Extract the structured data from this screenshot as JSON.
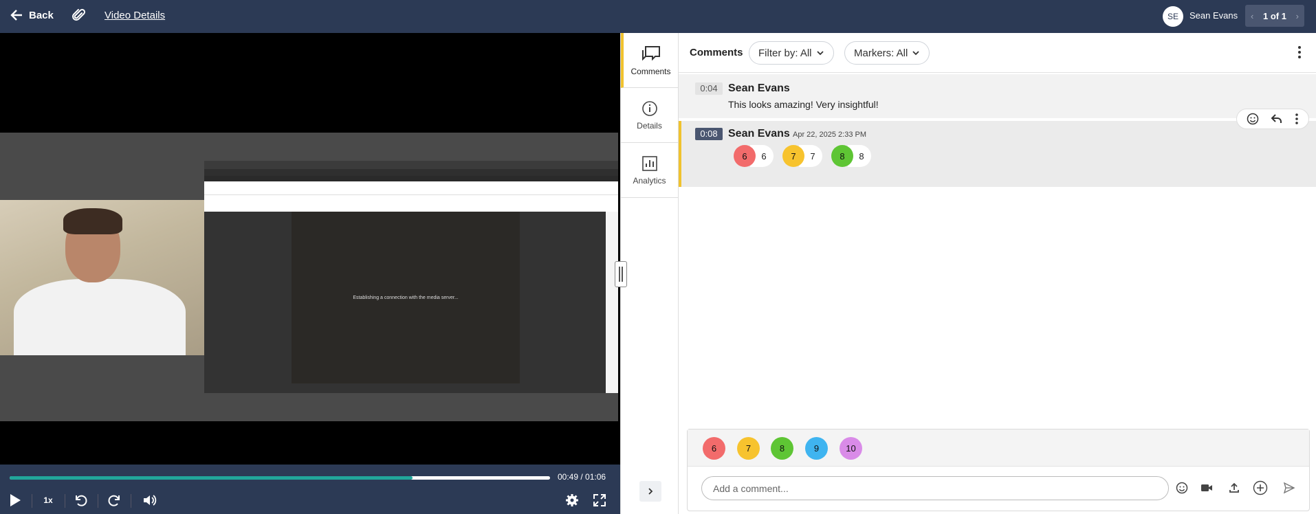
{
  "header": {
    "back_label": "Back",
    "title": "Video Details",
    "avatar_initials": "SE",
    "user_name": "Sean Evans",
    "pager": "1 of 1"
  },
  "video": {
    "screen_message": "Establishing a connection with the media server...",
    "time": "00:49 / 01:06",
    "progress": 0.745,
    "speed": "1x",
    "accent_color": "#21a69a"
  },
  "rail": {
    "comments": "Comments",
    "details": "Details",
    "analytics": "Analytics"
  },
  "panel": {
    "title": "Comments",
    "filter_label": "Filter by: All",
    "markers_label": "Markers: All"
  },
  "comments": [
    {
      "timestamp": "0:04",
      "author": "Sean Evans",
      "text": "This looks amazing!  Very insightful!"
    },
    {
      "timestamp": "0:08",
      "author": "Sean Evans",
      "date": "Apr 22, 2025 2:33 PM",
      "markers": [
        {
          "label": "6",
          "value": "6",
          "color": "#f26b6b"
        },
        {
          "label": "7",
          "value": "7",
          "color": "#f7c32e"
        },
        {
          "label": "8",
          "value": "8",
          "color": "#5ec534"
        }
      ]
    }
  ],
  "composer": {
    "markers": [
      {
        "label": "6",
        "color": "#f26b6b"
      },
      {
        "label": "7",
        "color": "#f7c32e"
      },
      {
        "label": "8",
        "color": "#5ec534"
      },
      {
        "label": "9",
        "color": "#3fb4f0"
      },
      {
        "label": "10",
        "color": "#d98be8"
      }
    ],
    "placeholder": "Add a comment..."
  }
}
